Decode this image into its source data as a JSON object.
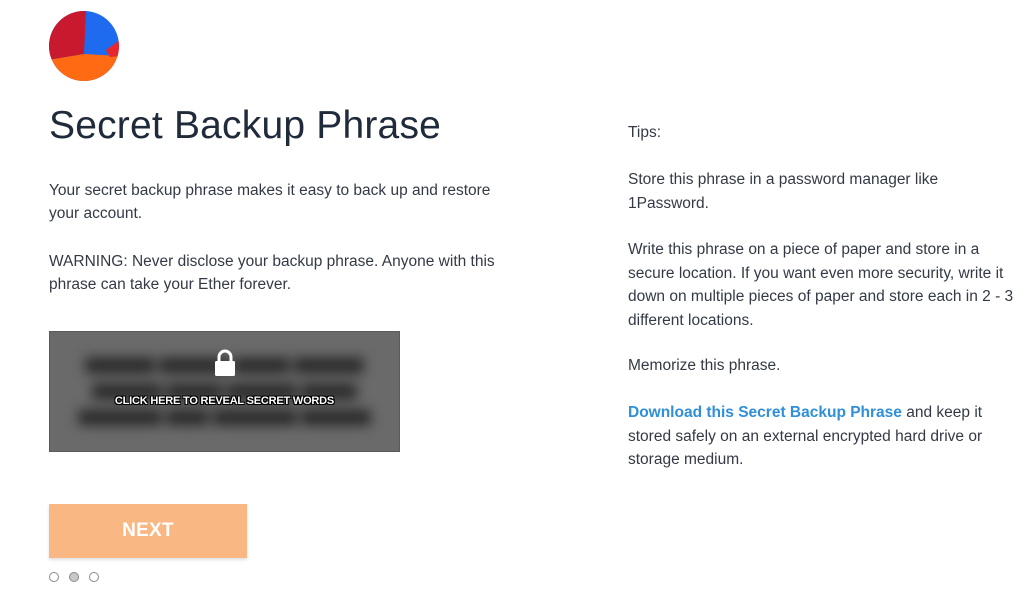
{
  "logo": {
    "icon": "metamask-fox-logo-icon",
    "colors": [
      "#1f6bf0",
      "#c8192e",
      "#ff6a13",
      "#e8262e"
    ]
  },
  "header": {
    "title": "Secret Backup Phrase"
  },
  "main": {
    "intro": "Your secret backup phrase makes it easy to back up and restore your account.",
    "warning": "WARNING: Never disclose your backup phrase. Anyone with this phrase can take your Ether forever.",
    "secret_box": {
      "reveal_label": "CLICK HERE TO REVEAL SECRET WORDS",
      "lock_icon": "lock-icon",
      "background_color": "#6a6a6a"
    },
    "next_label": "NEXT",
    "next_color": "#f9b784",
    "step_dots": {
      "total": 3,
      "current": 2
    }
  },
  "tips": {
    "heading": "Tips:",
    "tip1": "Store this phrase in a password manager like 1Password.",
    "tip2": "Write this phrase on a piece of paper and store in a secure location. If you want even more security, write it down on multiple pieces of paper and store each in 2 - 3 different locations.",
    "tip3": "Memorize this phrase.",
    "tip4_link": "Download this Secret Backup Phrase",
    "tip4_rest": " and keep it stored safely on an external encrypted hard drive or storage medium.",
    "link_color": "#2f8fd8"
  }
}
